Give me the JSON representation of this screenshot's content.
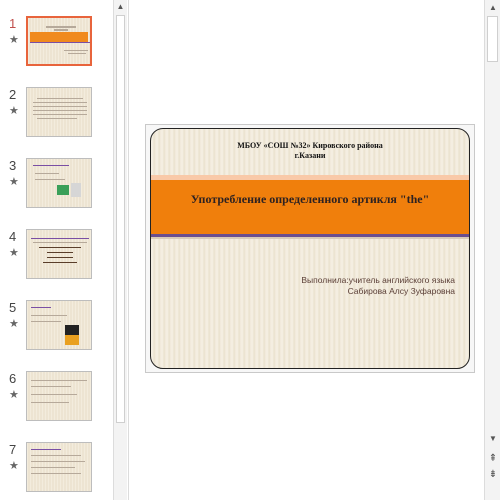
{
  "thumbnails": [
    {
      "number": "1",
      "star": "★",
      "selected": true
    },
    {
      "number": "2",
      "star": "★",
      "selected": false
    },
    {
      "number": "3",
      "star": "★",
      "selected": false
    },
    {
      "number": "4",
      "star": "★",
      "selected": false
    },
    {
      "number": "5",
      "star": "★",
      "selected": false
    },
    {
      "number": "6",
      "star": "★",
      "selected": false
    },
    {
      "number": "7",
      "star": "★",
      "selected": false
    }
  ],
  "slide": {
    "header_line1": "МБОУ «СОШ №32» Кировского района",
    "header_line2": "г.Казани",
    "title": "Употребление определенного артикля \"the\"",
    "author_line1": "Выполнила:учитель английского языка",
    "author_line2": "Сабирова Алсу Зуфаровна"
  },
  "scrollbar": {
    "up_icon": "▲",
    "down_icon": "▼",
    "prev_slide_icon": "⇞",
    "next_slide_icon": "⇟"
  },
  "colors": {
    "accent_orange": "#f07f0c",
    "purple_rule": "#6a4f8f",
    "selection": "#e8643c"
  }
}
